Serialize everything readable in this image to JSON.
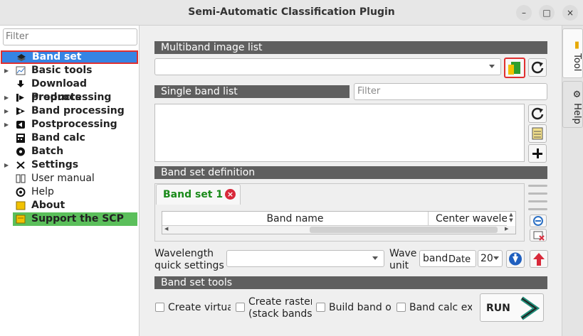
{
  "window": {
    "title": "Semi-Automatic Classification Plugin",
    "minimize": "–",
    "maximize": "□",
    "close": "×"
  },
  "sidebar": {
    "filter_placeholder": "Filter",
    "items": [
      {
        "label": "Band set",
        "bold": true,
        "expandable": false,
        "selected": true,
        "icon": "band-set-icon"
      },
      {
        "label": "Basic tools",
        "bold": true,
        "expandable": true,
        "icon": "basic-tools-icon"
      },
      {
        "label": "Download products",
        "bold": true,
        "expandable": false,
        "icon": "download-icon"
      },
      {
        "label": "Preprocessing",
        "bold": true,
        "expandable": true,
        "icon": "preprocessing-icon"
      },
      {
        "label": "Band processing",
        "bold": true,
        "expandable": true,
        "icon": "band-processing-icon"
      },
      {
        "label": "Postprocessing",
        "bold": true,
        "expandable": true,
        "icon": "postprocessing-icon"
      },
      {
        "label": "Band calc",
        "bold": true,
        "expandable": false,
        "icon": "calculator-icon"
      },
      {
        "label": "Batch",
        "bold": true,
        "expandable": false,
        "icon": "batch-icon"
      },
      {
        "label": "Settings",
        "bold": true,
        "expandable": true,
        "icon": "settings-icon"
      },
      {
        "label": "User manual",
        "bold": false,
        "expandable": false,
        "icon": "manual-icon"
      },
      {
        "label": "Help",
        "bold": false,
        "expandable": false,
        "icon": "help-icon"
      },
      {
        "label": "About",
        "bold": true,
        "expandable": false,
        "icon": "about-icon"
      },
      {
        "label": "Support the SCP",
        "bold": true,
        "expandable": false,
        "highlight": true,
        "icon": "support-icon"
      }
    ]
  },
  "main": {
    "multiband_header": "Multiband image list",
    "single_band_header": "Single band list",
    "single_band_filter_placeholder": "Filter",
    "band_set_definition_header": "Band set definition",
    "tab_label": "Band set 1",
    "table_headers": [
      "Band name",
      "Center wavelen"
    ],
    "wavelength_label_line1": "Wavelength",
    "wavelength_label_line2": "quick settings",
    "wave_unit_line1": "Wave",
    "wave_unit_line2": "unit",
    "wave_unit_value": "band",
    "date_label": "Date",
    "date_value": "20",
    "band_set_tools_header": "Band set tools",
    "options": [
      {
        "label": "Create virtua",
        "checked": false
      },
      {
        "label_line1": "Create raster",
        "label_line2": "(stack bands)",
        "checked": false
      },
      {
        "label": "Build band oν",
        "checked": false
      },
      {
        "label": "Band calc exρ",
        "checked": false
      }
    ],
    "run_label": "RUN"
  },
  "dock": {
    "tool_tab": "Tool",
    "help_tab": "Help"
  },
  "colors": {
    "accent": "#3584e4",
    "section_bar": "#5f5f5f",
    "highlight_red": "#e03030",
    "support_green": "#5bbf5b",
    "tab_green": "#1a8a1a"
  }
}
